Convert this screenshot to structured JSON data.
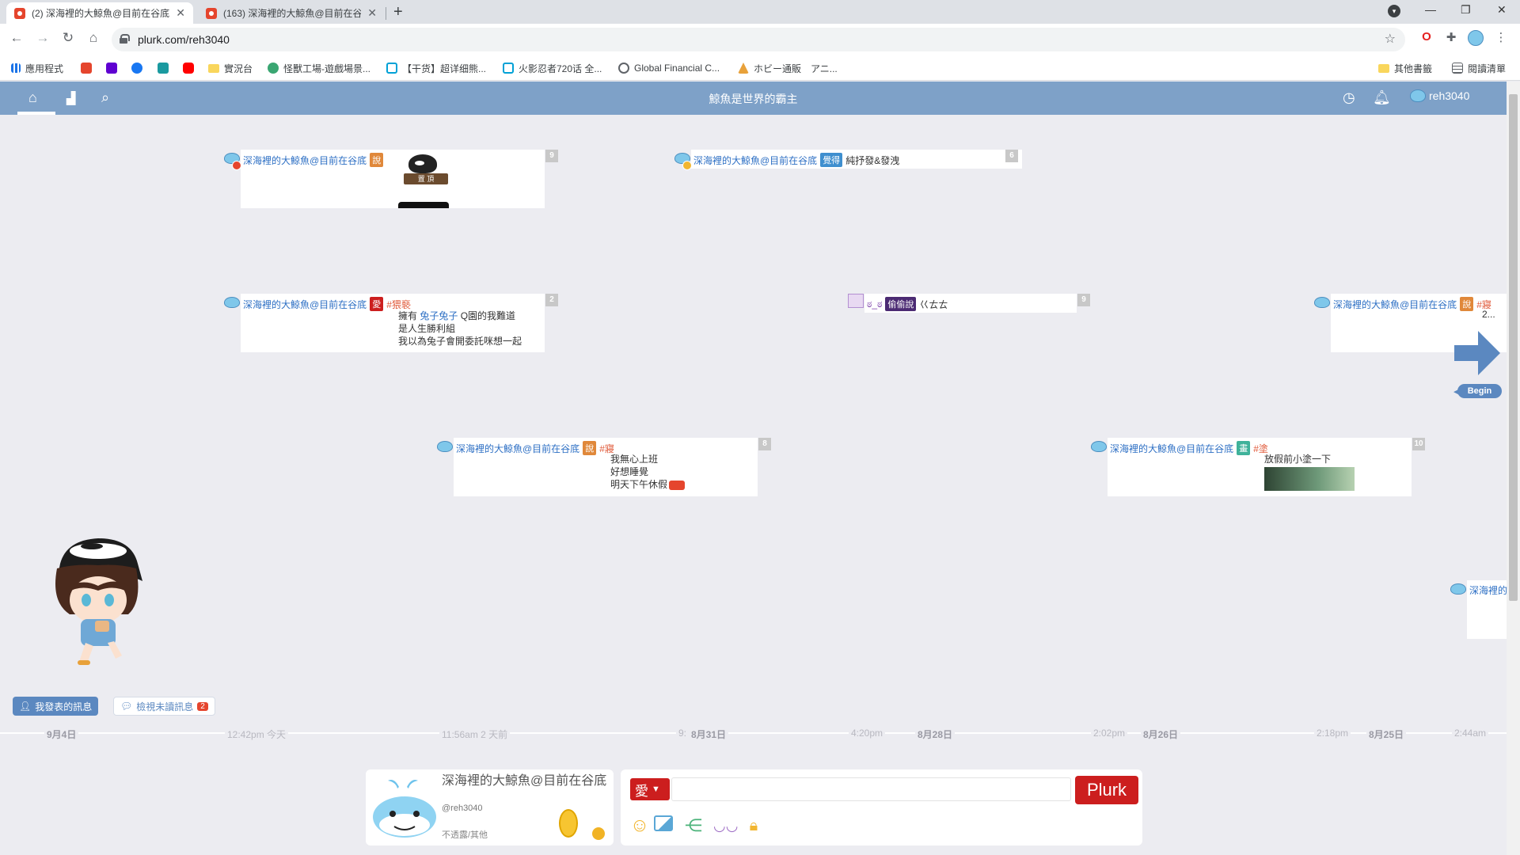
{
  "browser": {
    "tabs": [
      {
        "title": "(2) 深海裡的大鯨魚@目前在谷底",
        "active": true
      },
      {
        "title": "(163) 深海裡的大鯨魚@目前在谷",
        "active": false
      }
    ],
    "url": "plurk.com/reh3040",
    "bookmarks": [
      {
        "label": "應用程式",
        "icon": "apps-grid-icon"
      },
      {
        "label": "",
        "icon": "plurk-icon"
      },
      {
        "label": "",
        "icon": "yahoo-icon"
      },
      {
        "label": "",
        "icon": "facebook-icon"
      },
      {
        "label": "",
        "icon": "tw-icon"
      },
      {
        "label": "",
        "icon": "youtube-icon"
      },
      {
        "label": "實況台",
        "icon": "folder-icon"
      },
      {
        "label": "怪獸工場-遊戲場景...",
        "icon": "game-icon"
      },
      {
        "label": "【干货】超详细熊...",
        "icon": "bilibili-icon"
      },
      {
        "label": "火影忍者720话 全...",
        "icon": "bilibili-icon"
      },
      {
        "label": "Global Financial C...",
        "icon": "globe-icon"
      },
      {
        "label": "ホビー通販　アニ...",
        "icon": "hobby-icon"
      }
    ],
    "bookmarks_right": [
      {
        "label": "其他書籤",
        "icon": "folder-icon"
      },
      {
        "label": "閱讀清單",
        "icon": "reading-list-icon"
      }
    ]
  },
  "header": {
    "title": "鯨魚是世界的霸主",
    "username": "reh3040"
  },
  "plurks": [
    {
      "id": "p1",
      "name": "深海裡的大鯨魚@目前在谷底",
      "qualifier": "說",
      "qualifier_color": "#e0883a",
      "count": "9",
      "text": "",
      "badge": "pin-icon",
      "badge_color": "#e5452d"
    },
    {
      "id": "p2",
      "name": "深海裡的大鯨魚@目前在谷底",
      "qualifier": "覺得",
      "qualifier_color": "#3f8fcf",
      "count": "6",
      "text": "純抒發&發洩",
      "badge": "lock-icon",
      "badge_color": "#f2b630"
    },
    {
      "id": "p3",
      "name": "深海裡的大鯨魚@目前在谷底",
      "qualifier": "愛",
      "qualifier_color": "#cc1e1e",
      "count": "2",
      "tag": "#猥褻",
      "lines": [
        "擁有",
        "兔子兔子",
        " Q園的我難道",
        "是人生勝利組",
        "我以為兔子會開委託咪想一起"
      ]
    },
    {
      "id": "p4",
      "name": "ಠ_ಠ",
      "qualifier": "偷偷說",
      "qualifier_color": "#4b2a73",
      "count": "9",
      "text": "巜ㄊㄊ"
    },
    {
      "id": "p5",
      "name": "深海裡的大鯨魚@目前在谷底",
      "qualifier": "說",
      "qualifier_color": "#e0883a",
      "count": "",
      "tag": "#寢",
      "text": "2..."
    },
    {
      "id": "p6",
      "name": "深海裡的大鯨魚@目前在谷底",
      "qualifier": "說",
      "qualifier_color": "#e0883a",
      "count": "8",
      "tag": "#寢",
      "lines": [
        "我無心上班",
        "好想睡覺",
        "明天下午休假"
      ]
    },
    {
      "id": "p7",
      "name": "深海裡的大鯨魚@目前在谷底",
      "qualifier": "畫",
      "qualifier_color": "#3fb29a",
      "count": "10",
      "tag": "#塗",
      "text": "放假前小塗一下"
    },
    {
      "id": "p8",
      "name": "深海裡的",
      "qualifier": "",
      "count": "",
      "text": ""
    }
  ],
  "pinned_sign": "置 頂",
  "begin_label": "Begin",
  "buttons": {
    "my_posts": "我發表的訊息",
    "unread": "檢視未讀訊息",
    "unread_count": "2"
  },
  "timeline_axis": [
    {
      "label": "9月4日",
      "kind": "date"
    },
    {
      "label": "12:42pm 今天",
      "kind": "time"
    },
    {
      "label": "11:56am 2 天前",
      "kind": "time"
    },
    {
      "label": "9:",
      "kind": "time"
    },
    {
      "label": "8月31日",
      "kind": "date"
    },
    {
      "label": "4:20pm",
      "kind": "time"
    },
    {
      "label": "8月28日",
      "kind": "date"
    },
    {
      "label": "2:02pm",
      "kind": "time"
    },
    {
      "label": "8月26日",
      "kind": "date"
    },
    {
      "label": "2:18pm",
      "kind": "time"
    },
    {
      "label": "8月25日",
      "kind": "date"
    },
    {
      "label": "2:44am",
      "kind": "time"
    }
  ],
  "profile": {
    "display_name": "深海裡的大鯨魚@目前在谷底",
    "handle": "@reh3040",
    "privacy": "不透露/其他"
  },
  "composer": {
    "qualifier": "愛",
    "placeholder": "",
    "submit_label": "Plurk",
    "tools": [
      "emoji-icon",
      "image-icon",
      "share-icon",
      "mask-icon",
      "lock-icon"
    ]
  },
  "colors": {
    "header_bar": "#7ea1c8",
    "background": "#ececf1",
    "plurk_red": "#cc1e1e",
    "link_blue": "#2d6fc4"
  }
}
